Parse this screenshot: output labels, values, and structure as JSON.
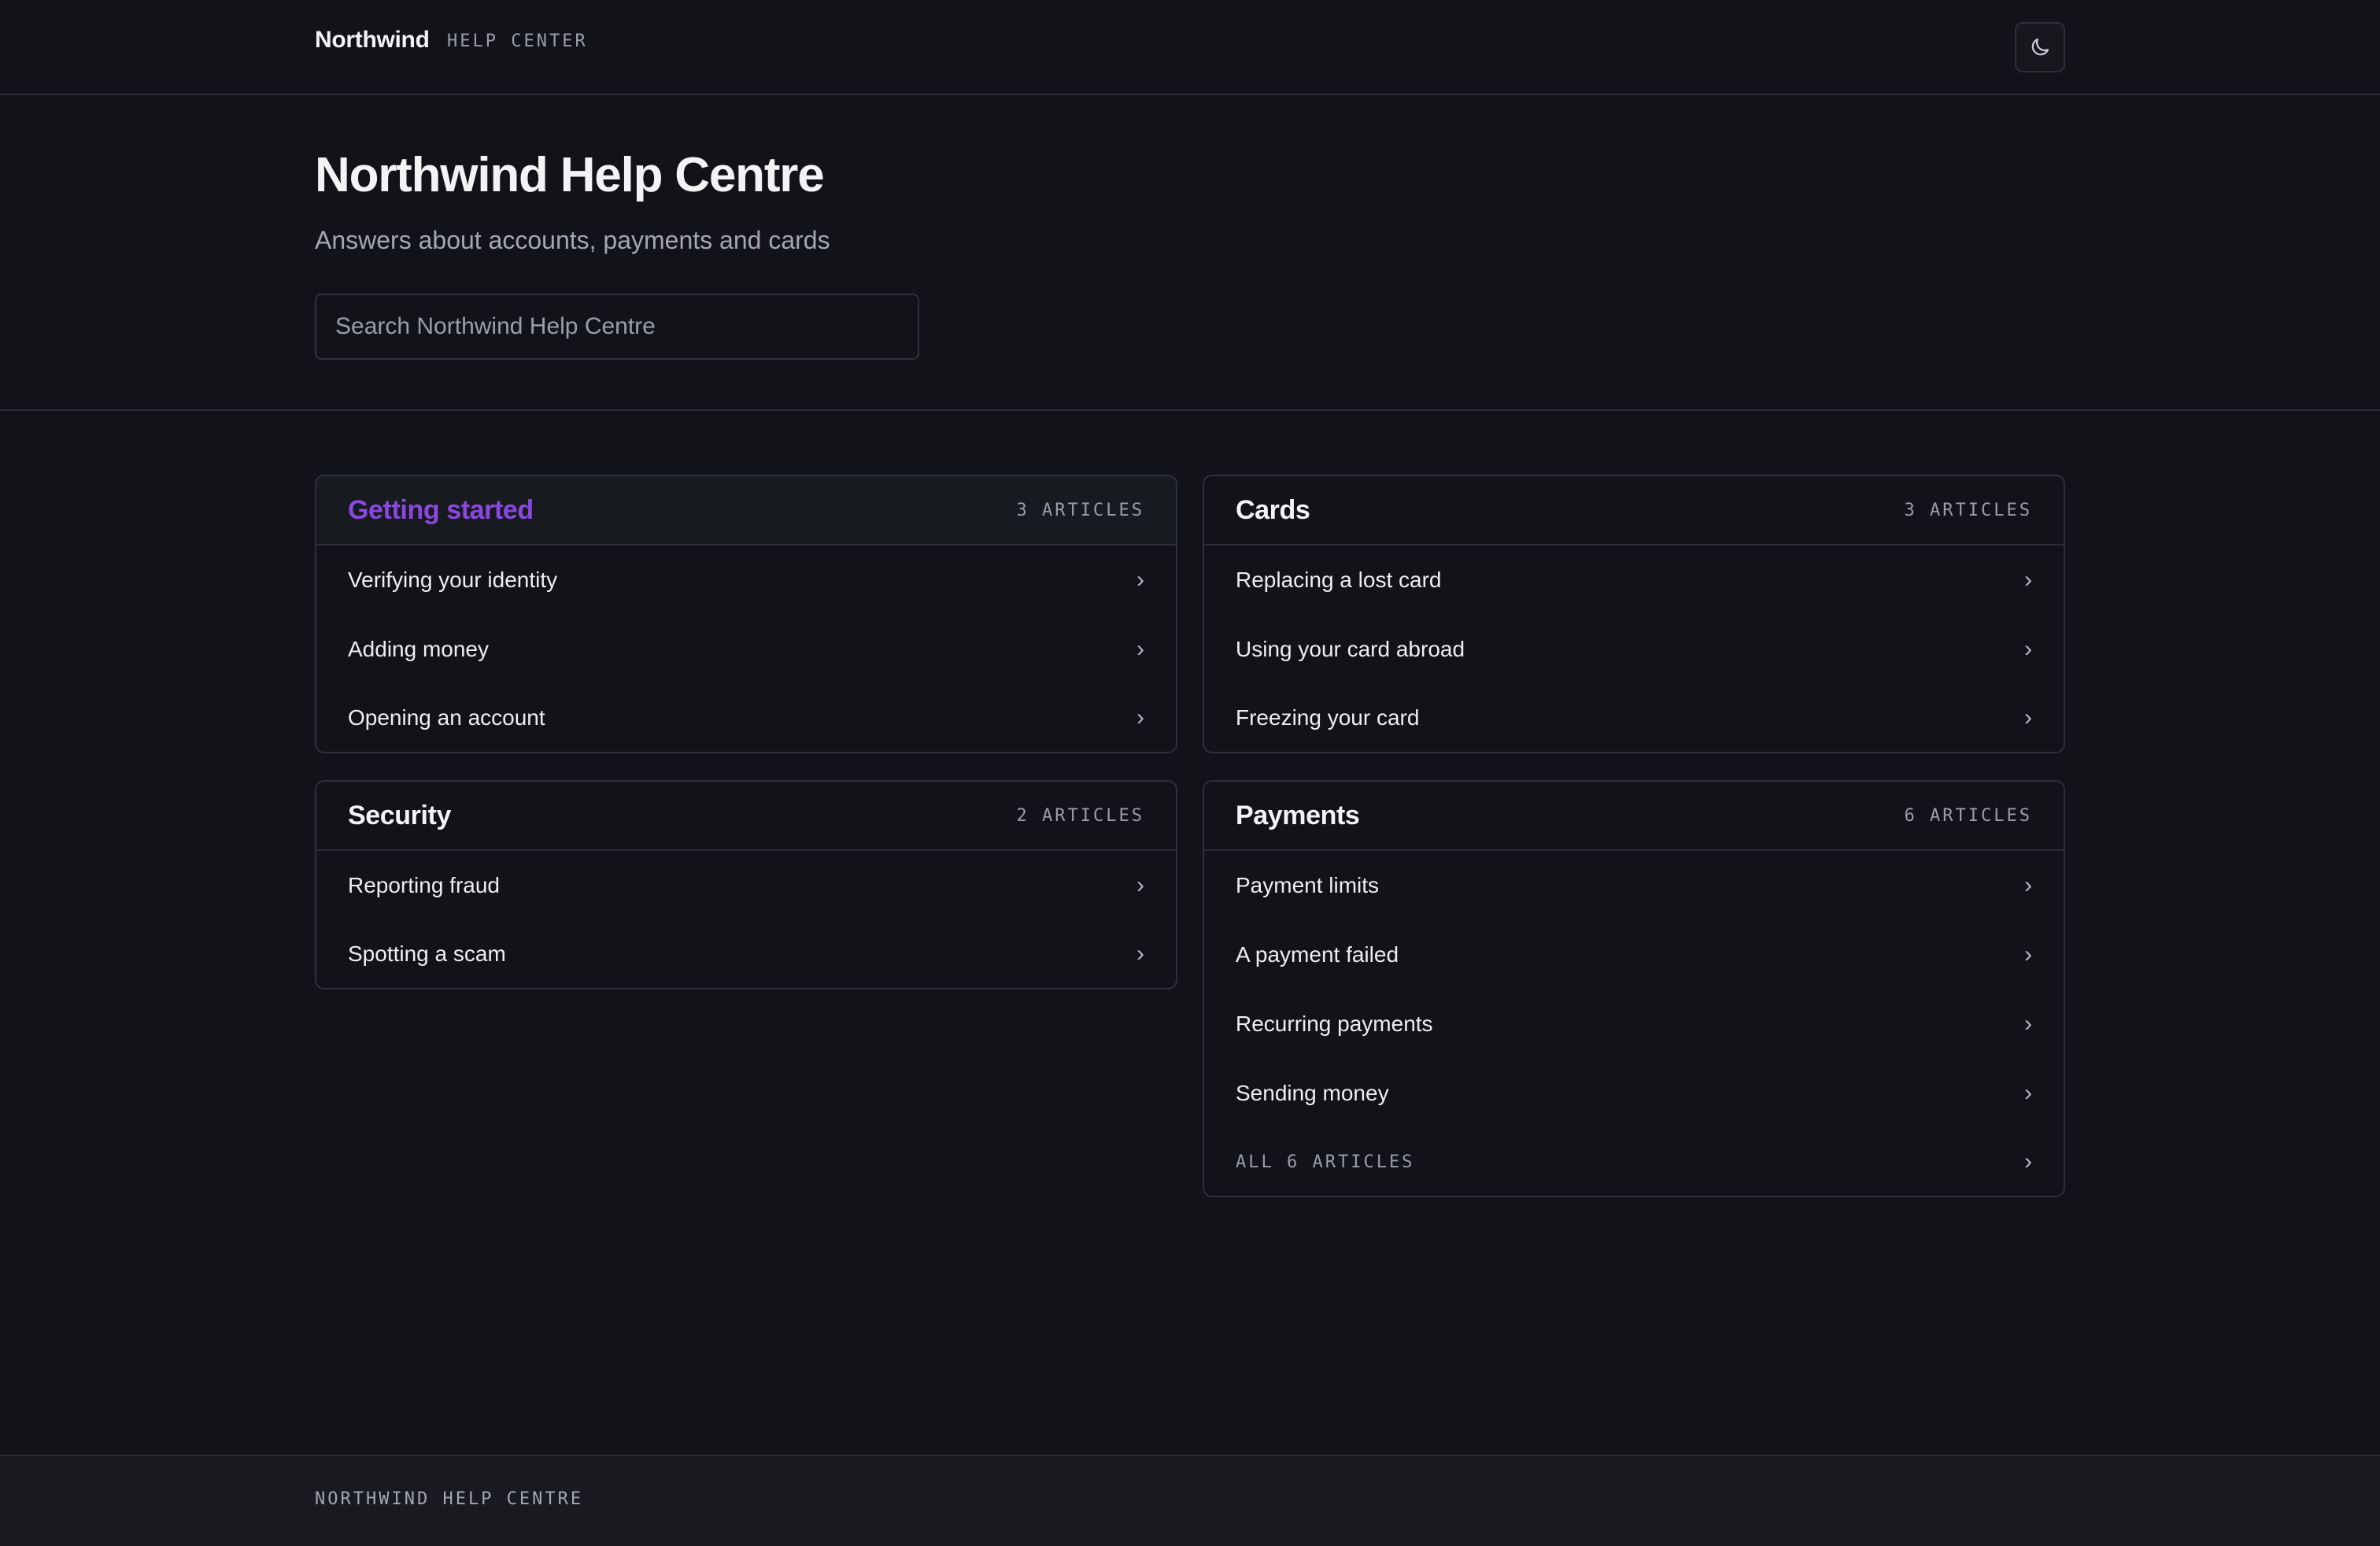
{
  "header": {
    "brand": "Northwind",
    "subtitle": "HELP CENTER",
    "theme_toggle_icon": "moon-icon"
  },
  "hero": {
    "title": "Northwind Help Centre",
    "subtitle": "Answers about accounts, payments and cards",
    "search_placeholder": "Search Northwind Help Centre",
    "search_value": ""
  },
  "colors": {
    "background": "#111318",
    "accent": "#8b48e0",
    "border": "#2e3139",
    "muted_text": "#9a9ea8"
  },
  "sections": {
    "getting_started": {
      "title": "Getting started",
      "count": "3 ARTICLES",
      "articles": [
        "Verifying your identity",
        "Adding money",
        "Opening an account"
      ]
    },
    "security": {
      "title": "Security",
      "count": "2 ARTICLES",
      "articles": [
        "Reporting fraud",
        "Spotting a scam"
      ]
    },
    "cards": {
      "title": "Cards",
      "count": "3 ARTICLES",
      "articles": [
        "Replacing a lost card",
        "Using your card abroad",
        "Freezing your card"
      ]
    },
    "payments": {
      "title": "Payments",
      "count": "6 ARTICLES",
      "articles": [
        "Payment limits",
        "A payment failed",
        "Recurring payments",
        "Sending money"
      ],
      "all_link": "ALL 6 ARTICLES"
    }
  },
  "chevron": "›",
  "footer": {
    "text": "NORTHWIND HELP CENTRE"
  }
}
